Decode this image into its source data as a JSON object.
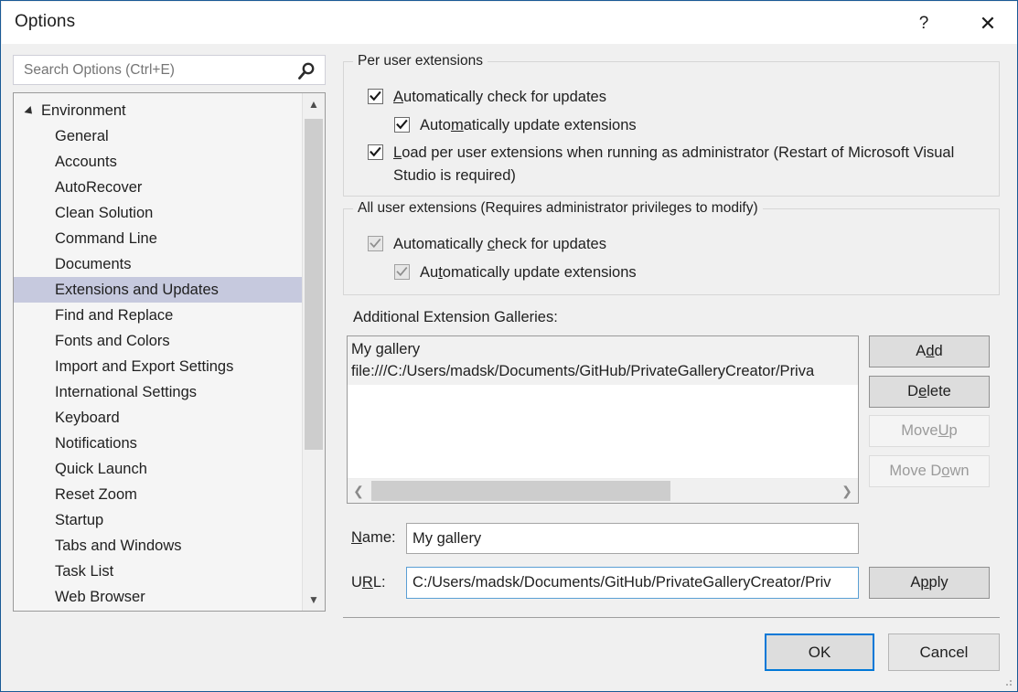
{
  "window": {
    "title": "Options",
    "help_icon": "question-mark-icon",
    "close_icon": "close-icon",
    "border_color": "#1a5a96"
  },
  "search": {
    "placeholder": "Search Options (Ctrl+E)",
    "value": "",
    "icon": "search-icon"
  },
  "tree": {
    "root": {
      "label": "Environment",
      "expanded": true
    },
    "items": [
      {
        "label": "General",
        "selected": false
      },
      {
        "label": "Accounts",
        "selected": false
      },
      {
        "label": "AutoRecover",
        "selected": false
      },
      {
        "label": "Clean Solution",
        "selected": false
      },
      {
        "label": "Command Line",
        "selected": false
      },
      {
        "label": "Documents",
        "selected": false
      },
      {
        "label": "Extensions and Updates",
        "selected": true
      },
      {
        "label": "Find and Replace",
        "selected": false
      },
      {
        "label": "Fonts and Colors",
        "selected": false
      },
      {
        "label": "Import and Export Settings",
        "selected": false
      },
      {
        "label": "International Settings",
        "selected": false
      },
      {
        "label": "Keyboard",
        "selected": false
      },
      {
        "label": "Notifications",
        "selected": false
      },
      {
        "label": "Quick Launch",
        "selected": false
      },
      {
        "label": "Reset Zoom",
        "selected": false
      },
      {
        "label": "Startup",
        "selected": false
      },
      {
        "label": "Tabs and Windows",
        "selected": false
      },
      {
        "label": "Task List",
        "selected": false
      },
      {
        "label": "Web Browser",
        "selected": false
      }
    ],
    "selection_color": "#c6c9de",
    "scroll_up_icon": "chevron-up-icon",
    "scroll_down_icon": "chevron-down-icon"
  },
  "per_user_group": {
    "legend": "Per user extensions",
    "checkboxes": [
      {
        "label_pre": "",
        "label_accel": "A",
        "label_post": "utomatically check for updates",
        "checked": true,
        "enabled": true,
        "indent": false
      },
      {
        "label_pre": "Auto",
        "label_accel": "m",
        "label_post": "atically update extensions",
        "checked": true,
        "enabled": true,
        "indent": true
      },
      {
        "label_pre": "",
        "label_accel": "L",
        "label_post": "oad per user extensions when running as administrator (Restart of Microsoft Visual Studio is required)",
        "checked": true,
        "enabled": true,
        "indent": false
      }
    ]
  },
  "all_user_group": {
    "legend": "All user extensions (Requires administrator privileges to modify)",
    "checkboxes": [
      {
        "label_pre": "Automatically ",
        "label_accel": "c",
        "label_post": "heck for updates",
        "checked": true,
        "enabled": false,
        "indent": false
      },
      {
        "label_pre": "Au",
        "label_accel": "t",
        "label_post": "omatically update extensions",
        "checked": true,
        "enabled": false,
        "indent": true
      }
    ]
  },
  "galleries": {
    "label": "Additional Extension Galleries:",
    "items": [
      {
        "name": "My gallery",
        "url": "file:///C:/Users/madsk/Documents/GitHub/PrivateGalleryCreator/Priva",
        "selected": true
      }
    ],
    "scroll_left_icon": "chevron-left-icon",
    "scroll_right_icon": "chevron-right-icon"
  },
  "side_buttons": [
    {
      "pre": "A",
      "accel": "d",
      "post": "d",
      "enabled": true
    },
    {
      "pre": "D",
      "accel": "e",
      "post": "lete",
      "enabled": true
    },
    {
      "pre": "Move ",
      "accel": "U",
      "post": "p",
      "enabled": false
    },
    {
      "pre": "Move D",
      "accel": "o",
      "post": "wn",
      "enabled": false
    }
  ],
  "fields": {
    "name": {
      "label_pre": "",
      "label_accel": "N",
      "label_post": "ame:",
      "value": "My gallery",
      "focused": false
    },
    "url": {
      "label_pre": "U",
      "label_accel": "R",
      "label_post": "L:",
      "value": "C:/Users/madsk/Documents/GitHub/PrivateGalleryCreator/Priv",
      "focused": true,
      "focus_color": "#5a9fd4"
    },
    "apply": {
      "pre": "A",
      "accel": "p",
      "post": "ply",
      "enabled": true
    }
  },
  "footer": {
    "ok": "OK",
    "cancel": "Cancel",
    "ok_default_border": "#0078d7"
  }
}
